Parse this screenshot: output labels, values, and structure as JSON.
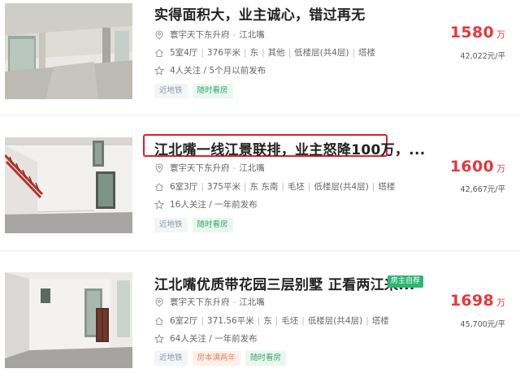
{
  "listings": [
    {
      "title": "实得面积大，业主诚心，错过再无",
      "community": "寰宇天下东升府",
      "district": "江北嘴",
      "info": [
        "5室4厅",
        "376平米",
        "东",
        "其他",
        "低楼层(共4层)",
        "塔楼"
      ],
      "follow": "4人关注 / 5个月以前发布",
      "tags": [
        "近地铁",
        "随时看房"
      ],
      "price": "1580",
      "price_unit": "万",
      "unit_price": "42,022元/平"
    },
    {
      "title": "江北嘴一线江景联排，业主怒降100万，...",
      "community": "寰宇天下东升府",
      "district": "江北嘴",
      "info": [
        "6室3厅",
        "375平米",
        "东 东南",
        "毛坯",
        "低楼层(共4层)",
        "塔楼"
      ],
      "follow": "16人关注 / 一年前发布",
      "tags": [
        "近地铁",
        "随时看房"
      ],
      "price": "1600",
      "price_unit": "万",
      "unit_price": "42,667元/平"
    },
    {
      "title": "江北嘴优质带花园三层别墅 正看两江来...",
      "badge": "房主自荐",
      "community": "寰宇天下东升府",
      "district": "江北嘴",
      "info": [
        "6室2厅",
        "371.56平米",
        "东",
        "毛坯",
        "低楼层(共4层)",
        "塔楼"
      ],
      "follow": "64人关注 / 一年前发布",
      "tags": [
        "近地铁",
        "房本满两年",
        "随时看房"
      ],
      "price": "1698",
      "price_unit": "万",
      "unit_price": "45,700元/平"
    }
  ],
  "colors": {
    "price_red": "#e4393c",
    "highlight_border": "#d9232d",
    "tag_green": "#33a86a",
    "tag_blue_gray": "#849aae",
    "tag_orange": "#e3845a",
    "badge_green": "#2eb672"
  },
  "icons": {
    "location": "location-pin-icon",
    "house": "house-icon",
    "follow": "star-icon"
  }
}
